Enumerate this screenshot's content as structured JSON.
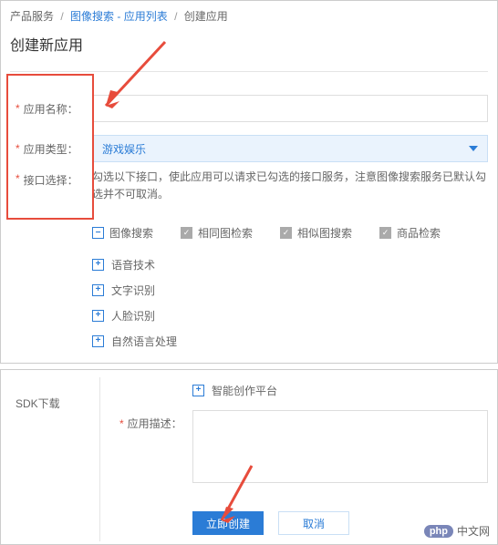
{
  "breadcrumb": {
    "item1": "产品服务",
    "item2": "图像搜索 - 应用列表",
    "item3": "创建应用",
    "sep": "/"
  },
  "page_title": "创建新应用",
  "form": {
    "name_label": "应用名称：",
    "name_value": "",
    "type_label": "应用类型：",
    "type_value": "游戏娱乐",
    "iface_label": "接口选择：",
    "iface_hint": "勾选以下接口，使此应用可以请求已勾选的接口服务，注意图像搜索服务已默认勾选并不可取消。"
  },
  "checks": {
    "c1": "图像搜索",
    "c2": "相同图检索",
    "c3": "相似图搜索",
    "c4": "商品检索"
  },
  "tree": {
    "t1": "语音技术",
    "t2": "文字识别",
    "t3": "人脸识别",
    "t4": "自然语言处理"
  },
  "panel2": {
    "sdk_label": "SDK下载",
    "smart": "智能创作平台",
    "desc_label": "应用描述：",
    "desc_value": ""
  },
  "buttons": {
    "create": "立即创建",
    "cancel": "取消"
  },
  "badge": {
    "logo": "php",
    "text": "中文网"
  }
}
